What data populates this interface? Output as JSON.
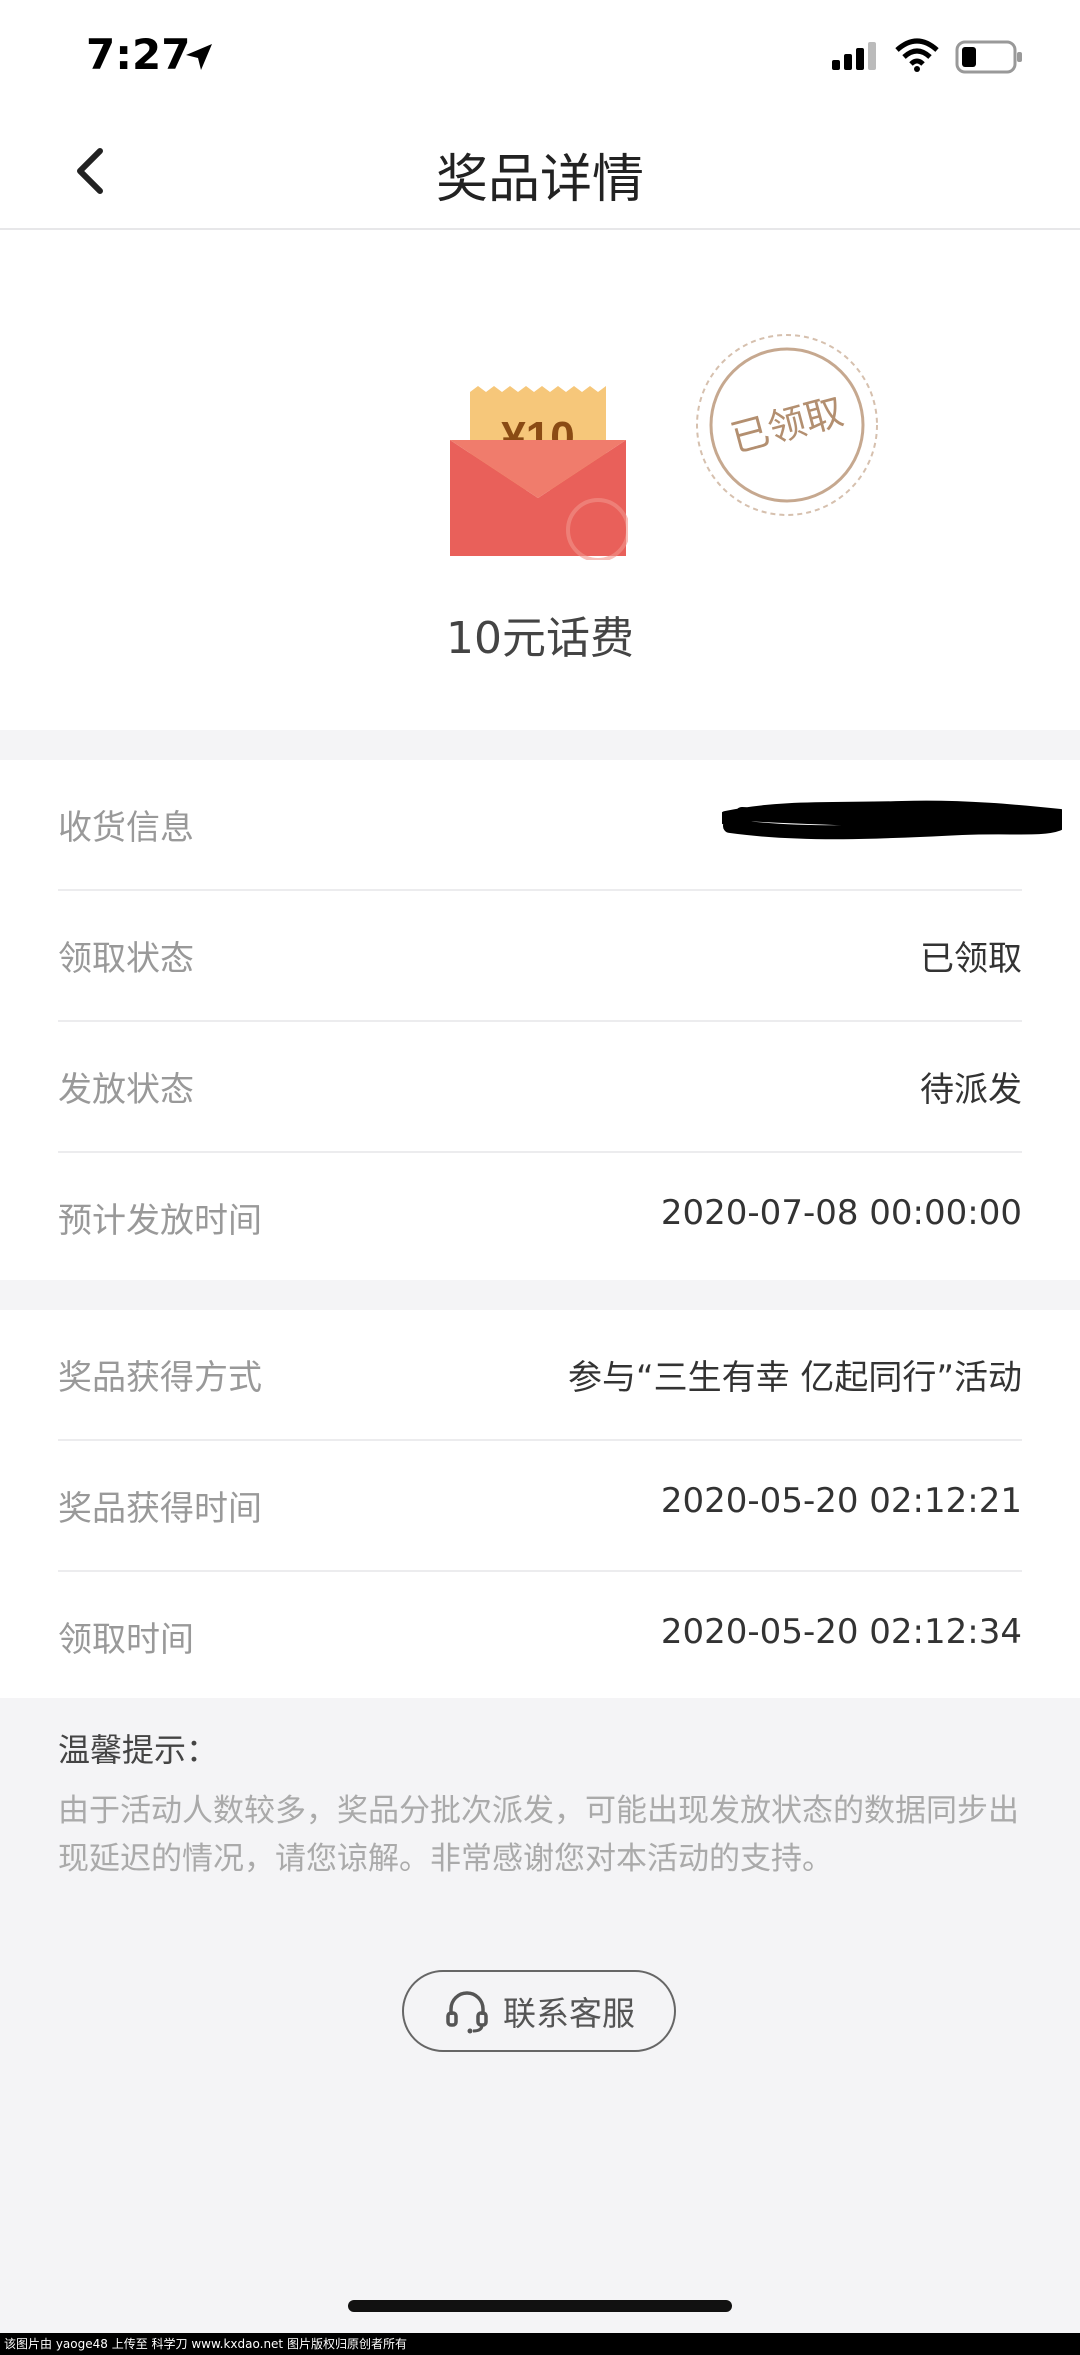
{
  "status_bar": {
    "time": "7:27"
  },
  "nav": {
    "title": "奖品详情"
  },
  "prize": {
    "amount_text": "¥10",
    "stamp_text": "已领取",
    "name": "10元话费"
  },
  "section_a": {
    "rows": [
      {
        "label": "收货信息",
        "value": ""
      },
      {
        "label": "领取状态",
        "value": "已领取"
      },
      {
        "label": "发放状态",
        "value": "待派发"
      },
      {
        "label": "预计发放时间",
        "value": "2020-07-08 00:00:00"
      }
    ]
  },
  "section_b": {
    "rows": [
      {
        "label": "奖品获得方式",
        "value": "参与“三生有幸 亿起同行”活动"
      },
      {
        "label": "奖品获得时间",
        "value": "2020-05-20 02:12:21"
      },
      {
        "label": "领取时间",
        "value": "2020-05-20 02:12:34"
      }
    ]
  },
  "tips": {
    "title": "温馨提示：",
    "text": "由于活动人数较多，奖品分批次派发，可能出现发放状态的数据同步出现延迟的情况，请您谅解。非常感谢您对本活动的支持。"
  },
  "contact": {
    "label": "联系客服"
  },
  "watermark": "该图片由 yaoge48 上传至 科学刀 www.kxdao.net 图片版权归原创者所有",
  "colors": {
    "envelope": "#e9605a",
    "coupon": "#f6c77a",
    "stamp": "#c6a88f"
  }
}
